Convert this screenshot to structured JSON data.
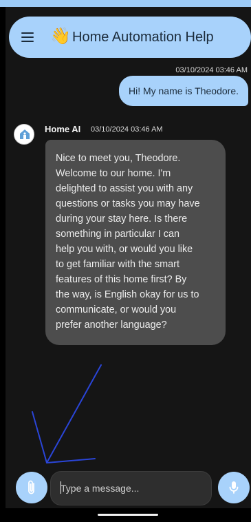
{
  "app_bar": {
    "title": "Home Automation Help",
    "wave_emoji": "👋",
    "menu_icon": "menu-icon"
  },
  "messages": {
    "user": {
      "timestamp": "03/10/2024 03:46 AM",
      "text": "Hi! My name is Theodore."
    },
    "ai": {
      "sender": "Home AI",
      "timestamp": "03/10/2024 03:46 AM",
      "avatar_icon": "home-icon",
      "lines": [
        "Nice to meet you, Theodore.",
        "Welcome to our home. I'm",
        "delighted to assist you with any",
        "questions or tasks you may have",
        "during your stay here. Is there",
        "something in particular I can",
        "help you with, or would you like",
        "to get familiar with the smart",
        "features of this home first? By",
        "the way, is English okay for us to",
        "communicate, or would you",
        "prefer another language?"
      ]
    }
  },
  "composer": {
    "placeholder": "Type a message...",
    "attach_icon": "paperclip-icon",
    "mic_icon": "microphone-icon"
  },
  "colors": {
    "accent": "#a8d2fb",
    "background": "#151515",
    "ai_bubble": "#4d4d4d",
    "annotation_arrow": "#2a45d8"
  }
}
